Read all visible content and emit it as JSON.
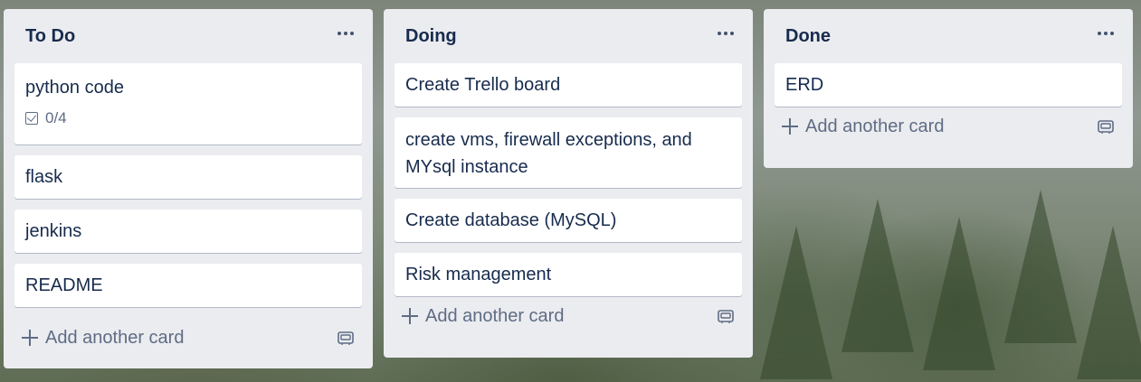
{
  "board": {
    "lists": [
      {
        "title": "To Do",
        "cards": [
          {
            "text": "python code",
            "checklist": "0/4"
          },
          {
            "text": "flask"
          },
          {
            "text": "jenkins"
          },
          {
            "text": "README"
          }
        ],
        "add_label": "Add another card"
      },
      {
        "title": "Doing",
        "cards": [
          {
            "text": "Create Trello board"
          },
          {
            "text": "create vms, firewall exceptions, and MYsql instance"
          },
          {
            "text": "Create database (MySQL)"
          },
          {
            "text": "Risk management"
          }
        ],
        "add_label": "Add another card"
      },
      {
        "title": "Done",
        "cards": [
          {
            "text": "ERD"
          }
        ],
        "add_label": "Add another card"
      }
    ]
  },
  "colors": {
    "list_bg": "#ebecf0",
    "card_bg": "#ffffff",
    "title_text": "#172b4d",
    "muted_text": "#5e6c84"
  },
  "icons": {
    "menu": "ellipsis-icon",
    "checklist": "checkbox-icon",
    "add": "plus-icon",
    "template": "card-template-icon"
  }
}
